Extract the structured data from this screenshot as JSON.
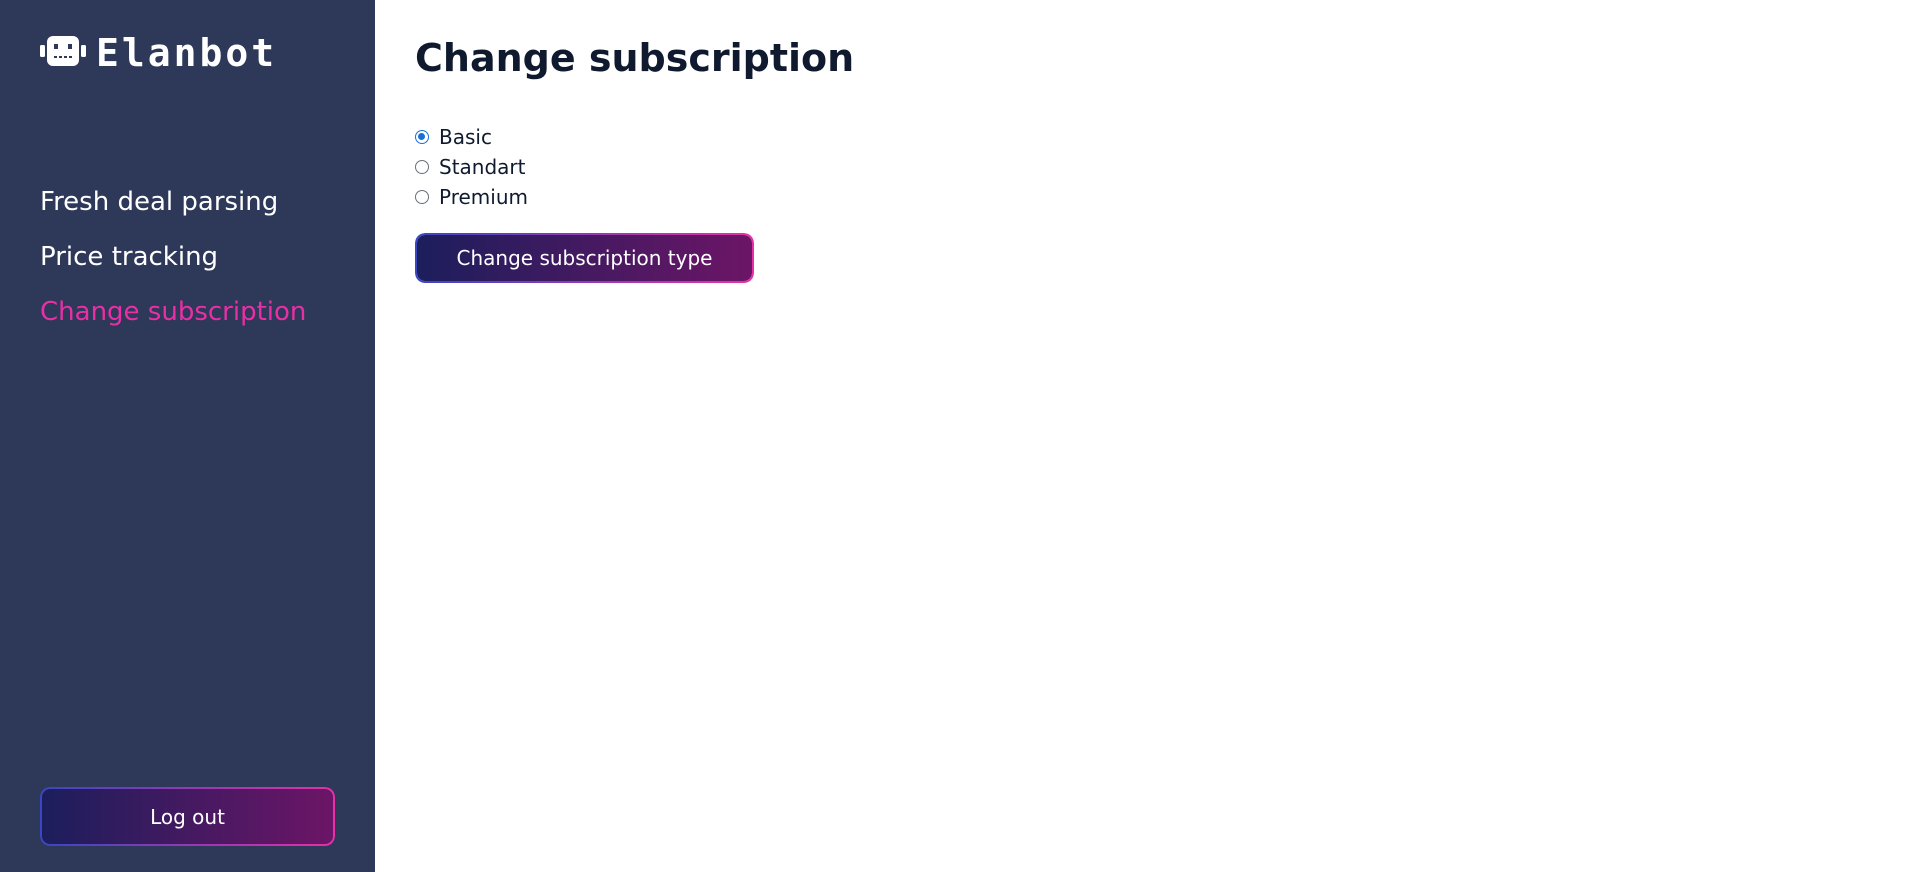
{
  "brand": {
    "name": "Elanbot",
    "logo_icon": "robot-icon"
  },
  "sidebar": {
    "items": [
      {
        "label": "Fresh deal parsing",
        "active": false
      },
      {
        "label": "Price tracking",
        "active": false
      },
      {
        "label": "Change subscription",
        "active": true
      }
    ],
    "logout_label": "Log out"
  },
  "main": {
    "title": "Change subscription",
    "options": [
      {
        "label": "Basic",
        "checked": true
      },
      {
        "label": "Standart",
        "checked": false
      },
      {
        "label": "Premium",
        "checked": false
      }
    ],
    "submit_label": "Change subscription type"
  },
  "colors": {
    "sidebar_bg": "#2e3858",
    "accent": "#e82fa6",
    "button_gradient_start": "#1c1e5c",
    "button_gradient_end": "#6c1566",
    "radio_checked": "#1a6fd6"
  }
}
